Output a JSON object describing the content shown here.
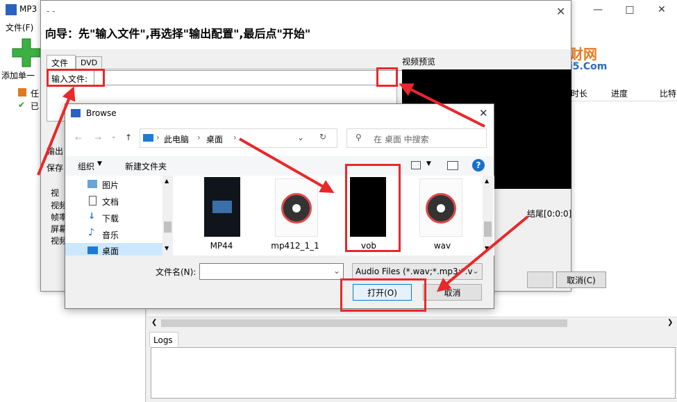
{
  "main": {
    "title": "MP3",
    "menu_file": "文件(F)",
    "toolbar_add": "添加单一",
    "tree_items": [
      "任",
      "已"
    ],
    "columns": [
      "时长",
      "进度",
      "比特"
    ],
    "logs_tab": "Logs",
    "watermark_a": "财网",
    "watermark_b": "i5.Com"
  },
  "wizard": {
    "title": "- -",
    "heading": "向导：先\"输入文件\",再选择\"输出配置\",最后点\"开始\"",
    "tab_file": "文件",
    "tab_dvd": "DVD",
    "input_label": "输入文件:",
    "preview_label": "视频预览",
    "left_labels": [
      "输出",
      "保存",
      "视",
      "视频",
      "帧率",
      "屏幕",
      "视频"
    ],
    "result_label": "结尾[0:0:0]",
    "cancel": "取消(C)"
  },
  "browse": {
    "title": "Browse",
    "breadcrumb": [
      "此电脑",
      "桌面"
    ],
    "search_placeholder": "在 桌面 中搜索",
    "organize": "组织",
    "new_folder": "新建文件夹",
    "nav_items": [
      "图片",
      "文档",
      "下载",
      "音乐",
      "桌面"
    ],
    "files": [
      "MP44",
      "mp412_1_1",
      "vob",
      "wav"
    ],
    "filename_label": "文件名(N):",
    "filter": "Audio Files (*.wav;*.mp3;*.v",
    "open": "打开(O)",
    "cancel": "取消"
  },
  "colors": {
    "accent": "#0078d7",
    "annotation": "#e8282a"
  }
}
